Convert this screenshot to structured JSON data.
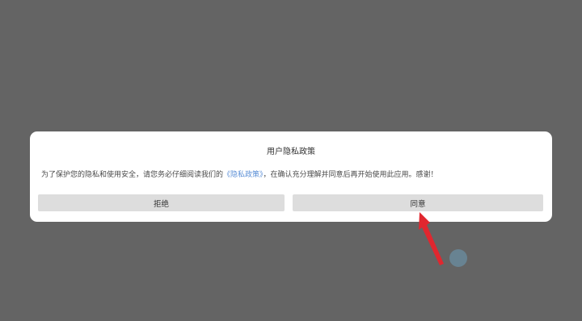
{
  "dialog": {
    "title": "用户隐私政策",
    "message_before": "为了保护您的隐私和使用安全，请您务必仔细阅读我们的",
    "policy_link": "《隐私政策》",
    "message_after": "，在确认充分理解并同意后再开始使用此应用。感谢！",
    "reject_label": "拒绝",
    "agree_label": "同意"
  },
  "colors": {
    "overlay": "#646464",
    "dialog_bg": "#ffffff",
    "button_bg": "#dddddd",
    "link": "#5b8fd6",
    "arrow": "#e0272f"
  }
}
